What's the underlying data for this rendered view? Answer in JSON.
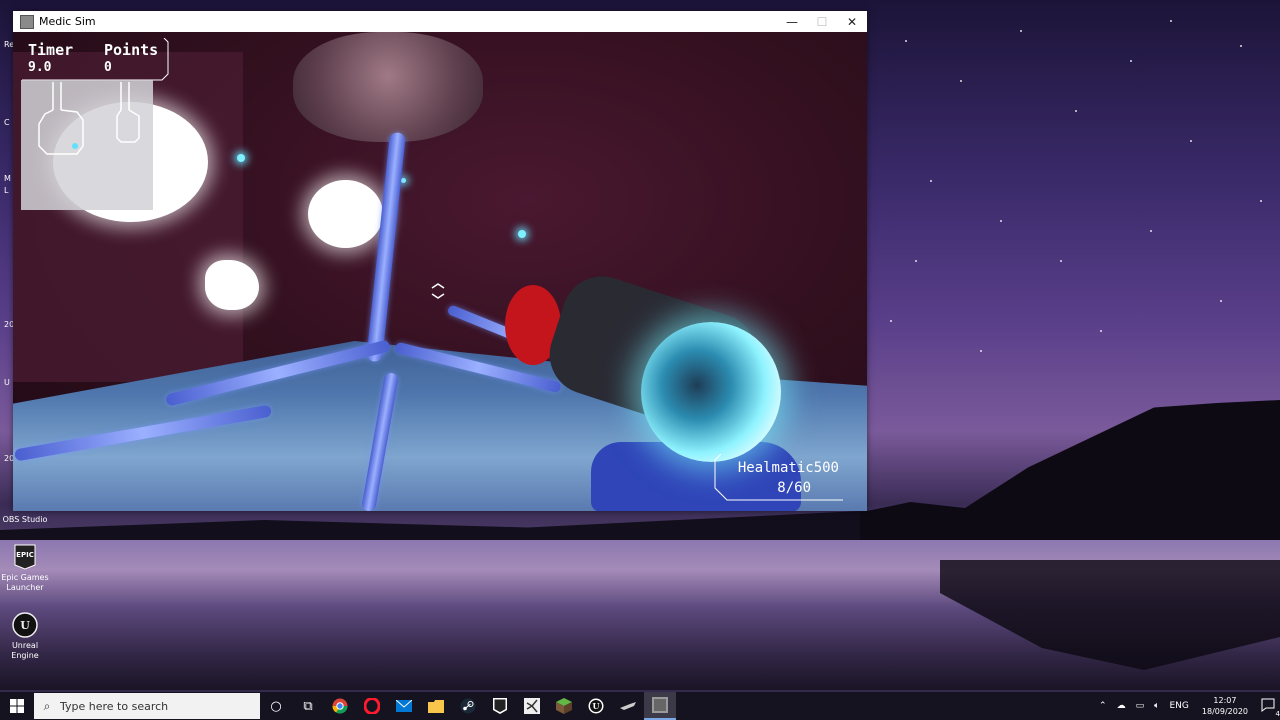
{
  "window": {
    "title": "Medic Sim",
    "controls": {
      "minimize": "—",
      "maximize": "☐",
      "close": "✕"
    }
  },
  "hud": {
    "timer_label": "Timer",
    "timer_value": "9.0",
    "points_label": "Points",
    "points_value": "0",
    "weapon_name": "Healmatic500",
    "ammo": "8/60"
  },
  "desktop": {
    "icons": [
      {
        "label": "OBS Studio",
        "icon": "obs-icon"
      },
      {
        "label": "Epic Games Launcher",
        "icon": "epic-games-icon"
      },
      {
        "label": "Unreal Engine",
        "icon": "unreal-engine-icon"
      }
    ],
    "edge_fragments": [
      "Re",
      "C",
      "M",
      "L",
      "20",
      "U",
      "20"
    ]
  },
  "taskbar": {
    "search_placeholder": "Type here to search",
    "apps": [
      "cortana-icon",
      "task-view-icon",
      "chrome-icon",
      "opera-icon",
      "mail-icon",
      "file-explorer-icon",
      "steam-icon",
      "epic-games-icon",
      "visual-studio-icon",
      "minecraft-icon",
      "unreal-engine-icon",
      "game-icon",
      "medic-sim-icon"
    ],
    "tray": {
      "language": "ENG",
      "time": "12:07",
      "date": "18/09/2020",
      "notifications": "4"
    }
  }
}
